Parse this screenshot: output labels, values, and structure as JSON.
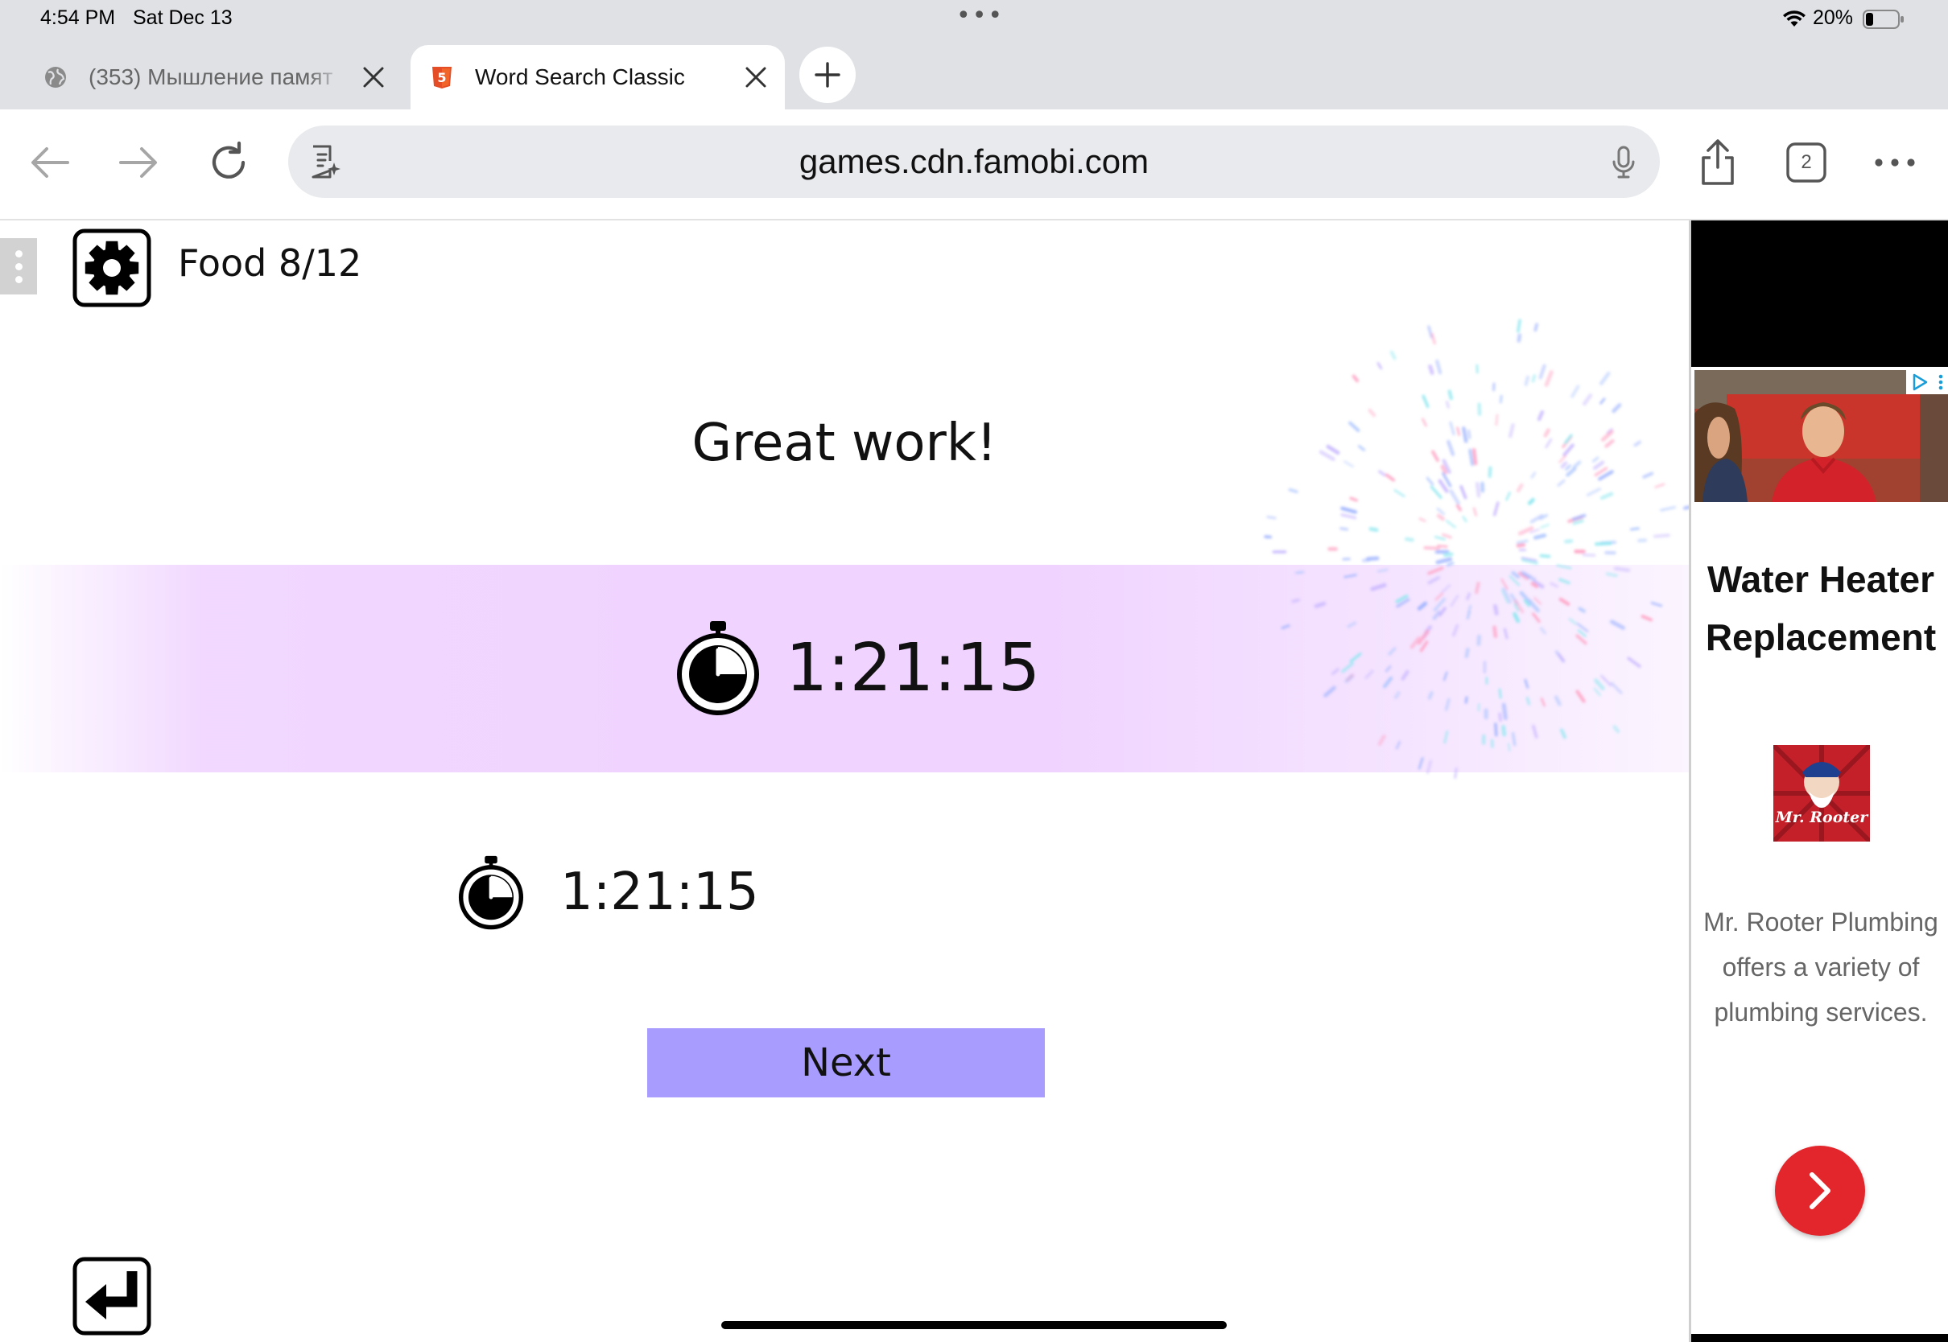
{
  "status_bar": {
    "time": "4:54 PM",
    "date": "Sat Dec 13",
    "battery": "20%"
  },
  "tabs": [
    {
      "title": "(353) Мышление памят",
      "active": false,
      "favicon": "globe-icon"
    },
    {
      "title": "Word Search Classic",
      "active": true,
      "favicon": "html5-icon"
    }
  ],
  "toolbar": {
    "url": "games.cdn.famobi.com",
    "tab_count": "2"
  },
  "game": {
    "level_label": "Food 8/12",
    "heading": "Great work!",
    "current_time": "1:21:15",
    "best_time": "1:21:15",
    "next_label": "Next"
  },
  "ad": {
    "headline": "Water Heater Replacement",
    "body": "Mr. Rooter Plumbing offers a variety of plumbing services.",
    "logo_text": "Mr. Rooter"
  },
  "colors": {
    "next_button": "#a89cff",
    "band": "#f0d4ff",
    "ad_cta": "#e3262b",
    "chrome": "#dfe1e5"
  }
}
